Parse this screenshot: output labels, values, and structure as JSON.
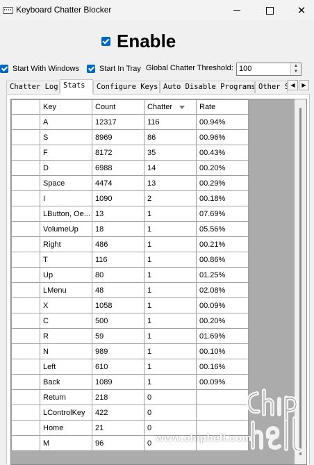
{
  "window": {
    "title": "Keyboard Chatter Blocker",
    "icon": "keyboard-icon",
    "controls": {
      "minimize": "minimize-icon",
      "maximize": "maximize-icon",
      "close": "✕"
    }
  },
  "enable": {
    "label": "Enable",
    "checked": true
  },
  "options": {
    "start_with_windows": {
      "label": "Start With Windows",
      "checked": true
    },
    "start_in_tray": {
      "label": "Start In Tray",
      "checked": true
    },
    "threshold": {
      "label": "Global Chatter Threshold:",
      "value": "100"
    }
  },
  "tabs": [
    {
      "label": "Chatter Log",
      "active": false
    },
    {
      "label": "Stats",
      "active": true
    },
    {
      "label": "Configure Keys",
      "active": false
    },
    {
      "label": "Auto Disable Programs",
      "active": false
    },
    {
      "label": "Other Se",
      "active": false
    }
  ],
  "tab_scroll": {
    "left": "◀",
    "right": "▶"
  },
  "stats_table": {
    "columns": [
      "Key",
      "Count",
      "Chatter",
      "Rate"
    ],
    "sorted_column": "Chatter",
    "rows": [
      [
        "A",
        "12317",
        "116",
        "00.94%"
      ],
      [
        "S",
        "8969",
        "86",
        "00.96%"
      ],
      [
        "F",
        "8172",
        "35",
        "00.43%"
      ],
      [
        "D",
        "6988",
        "14",
        "00.20%"
      ],
      [
        "Space",
        "4474",
        "13",
        "00.29%"
      ],
      [
        "I",
        "1090",
        "2",
        "00.18%"
      ],
      [
        "LButton, Oe...",
        "13",
        "1",
        "07.69%"
      ],
      [
        "VolumeUp",
        "18",
        "1",
        "05.56%"
      ],
      [
        "Right",
        "486",
        "1",
        "00.21%"
      ],
      [
        "T",
        "116",
        "1",
        "00.86%"
      ],
      [
        "Up",
        "80",
        "1",
        "01.25%"
      ],
      [
        "LMenu",
        "48",
        "1",
        "02.08%"
      ],
      [
        "X",
        "1058",
        "1",
        "00.09%"
      ],
      [
        "C",
        "500",
        "1",
        "00.20%"
      ],
      [
        "R",
        "59",
        "1",
        "01.69%"
      ],
      [
        "N",
        "989",
        "1",
        "00.10%"
      ],
      [
        "Left",
        "610",
        "1",
        "00.16%"
      ],
      [
        "Back",
        "1089",
        "1",
        "00.09%"
      ],
      [
        "Return",
        "218",
        "0",
        ""
      ],
      [
        "LControlKey",
        "422",
        "0",
        ""
      ],
      [
        "Home",
        "21",
        "0",
        ""
      ],
      [
        "M",
        "96",
        "0",
        ""
      ]
    ]
  },
  "watermark": {
    "text": "www.chiphell.com",
    "logo_text": "chip hell"
  }
}
